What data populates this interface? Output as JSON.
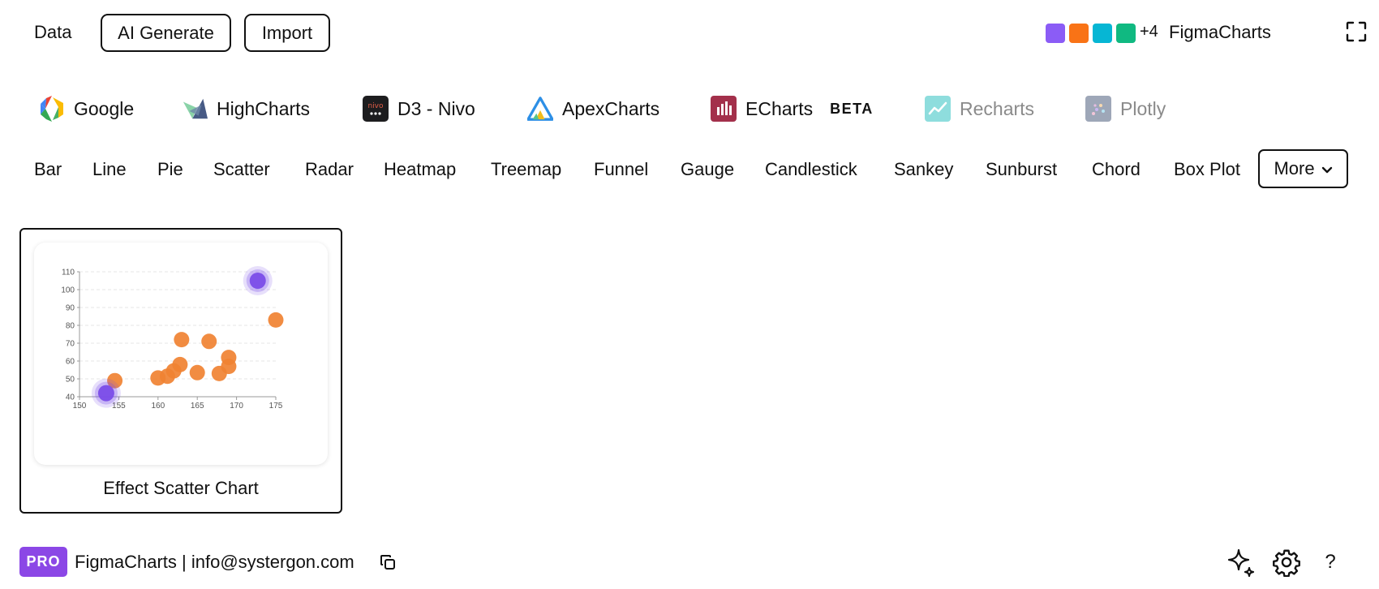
{
  "topbar": {
    "data_label": "Data",
    "ai_generate_label": "AI Generate",
    "import_label": "Import",
    "palette_colors": [
      "#8b5cf6",
      "#f97316",
      "#06b6d4",
      "#10b981"
    ],
    "more_colors_label": "+4",
    "brand_name": "FigmaCharts",
    "expand_icon": "expand-icon"
  },
  "libraries": [
    {
      "label": "Google",
      "icon": "google-charts-logo",
      "disabled": false
    },
    {
      "label": "HighCharts",
      "icon": "highcharts-logo",
      "disabled": false
    },
    {
      "label": "D3 - Nivo",
      "icon": "nivo-logo",
      "logo_text": "nivo",
      "disabled": false
    },
    {
      "label": "ApexCharts",
      "icon": "apexcharts-logo",
      "disabled": false
    },
    {
      "label": "ECharts",
      "icon": "echarts-logo",
      "badge": "BETA",
      "disabled": false
    },
    {
      "label": "Recharts",
      "icon": "recharts-logo",
      "disabled": true
    },
    {
      "label": "Plotly",
      "icon": "plotly-logo",
      "disabled": true
    }
  ],
  "chart_types": [
    "Bar",
    "Line",
    "Pie",
    "Scatter",
    "Radar",
    "Heatmap",
    "Treemap",
    "Funnel",
    "Gauge",
    "Candlestick",
    "Sankey",
    "Sunburst",
    "Chord",
    "Box Plot"
  ],
  "more_label": "More",
  "card": {
    "title": "Effect Scatter Chart"
  },
  "chart_data": {
    "type": "scatter",
    "xlim": [
      150,
      175
    ],
    "ylim": [
      40,
      110
    ],
    "x_ticks": [
      "150",
      "155",
      "160",
      "165",
      "170",
      "175"
    ],
    "y_ticks": [
      "40",
      "50",
      "60",
      "70",
      "80",
      "90",
      "100",
      "110"
    ],
    "series": [
      {
        "color": "#f08232",
        "points": [
          [
            154.5,
            49
          ],
          [
            160,
            50.5
          ],
          [
            161.2,
            51.5
          ],
          [
            162,
            54.5
          ],
          [
            162.8,
            58
          ],
          [
            163,
            72
          ],
          [
            165,
            53.5
          ],
          [
            166.5,
            71
          ],
          [
            167.8,
            53
          ],
          [
            169,
            62
          ],
          [
            169,
            57
          ],
          [
            175,
            83
          ]
        ]
      },
      {
        "color": "#7b4de8",
        "effect": "ripple",
        "points": [
          [
            153.4,
            42
          ],
          [
            172.7,
            105
          ]
        ]
      }
    ],
    "grid": true
  },
  "footer": {
    "pro_badge": "PRO",
    "text": "FigmaCharts | info@systergon.com",
    "help_label": "?"
  }
}
